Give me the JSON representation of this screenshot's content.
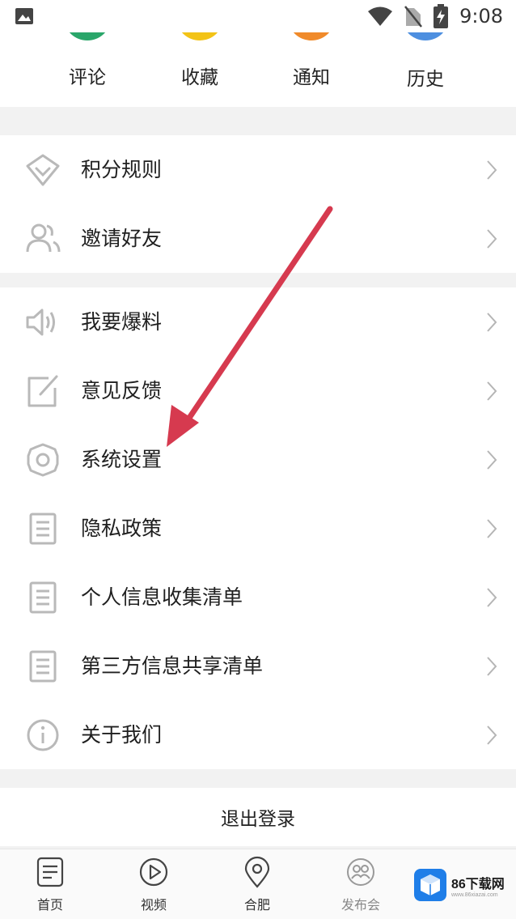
{
  "status_bar": {
    "time": "9:08",
    "icons": [
      "image-icon",
      "wifi-icon",
      "no-sim-icon",
      "battery-charging-icon"
    ]
  },
  "shortcuts": [
    {
      "label": "评论",
      "color": "#2aa66a"
    },
    {
      "label": "收藏",
      "color": "#f3c316"
    },
    {
      "label": "通知",
      "color": "#f08a2a"
    },
    {
      "label": "历史",
      "color": "#4d8fe0"
    }
  ],
  "menu_group_1": [
    {
      "label": "积分规则",
      "icon": "diamond-icon"
    },
    {
      "label": "邀请好友",
      "icon": "users-icon"
    }
  ],
  "menu_group_2": [
    {
      "label": "我要爆料",
      "icon": "speaker-icon"
    },
    {
      "label": "意见反馈",
      "icon": "edit-icon"
    },
    {
      "label": "系统设置",
      "icon": "gear-icon"
    },
    {
      "label": "隐私政策",
      "icon": "document-icon"
    },
    {
      "label": "个人信息收集清单",
      "icon": "document-icon"
    },
    {
      "label": "第三方信息共享清单",
      "icon": "document-icon"
    },
    {
      "label": "关于我们",
      "icon": "info-icon"
    }
  ],
  "logout_label": "退出登录",
  "tabbar": [
    {
      "label": "首页",
      "icon": "home-list-icon"
    },
    {
      "label": "视频",
      "icon": "play-icon"
    },
    {
      "label": "合肥",
      "icon": "location-icon"
    },
    {
      "label": "发布会",
      "icon": "press-icon"
    }
  ],
  "watermark": {
    "title": "86下载网",
    "sub": "www.86xiazai.com"
  },
  "colors": {
    "annotation_arrow": "#d63a4f",
    "icon_gray": "#b9b9b9"
  }
}
